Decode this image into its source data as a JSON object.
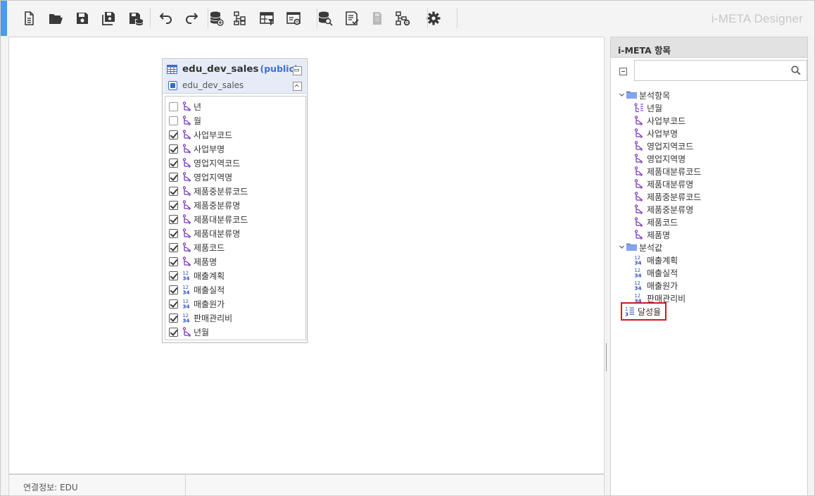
{
  "app": {
    "brand": "i-META Designer"
  },
  "toolbar": {
    "buttons": [
      {
        "name": "new-file-icon"
      },
      {
        "name": "open-folder-icon"
      },
      {
        "name": "save-icon"
      },
      {
        "name": "save-all-icon"
      },
      {
        "name": "save-db-icon"
      },
      {
        "name": "undo-icon"
      },
      {
        "name": "redo-icon"
      },
      {
        "name": "db-connect-icon"
      },
      {
        "name": "hierarchy-icon"
      },
      {
        "name": "table-filter-icon"
      },
      {
        "name": "window-settings-icon"
      },
      {
        "name": "db-search-icon"
      },
      {
        "name": "list-check-icon"
      },
      {
        "name": "document-disabled-icon"
      },
      {
        "name": "tree-settings-icon"
      },
      {
        "name": "gear-icon"
      }
    ]
  },
  "table": {
    "name": "edu_dev_sales",
    "schema": "(public)",
    "alias": "edu_dev_sales",
    "columns": [
      {
        "label": "년",
        "checked": false,
        "type": "dimension"
      },
      {
        "label": "월",
        "checked": false,
        "type": "dimension"
      },
      {
        "label": "사업부코드",
        "checked": true,
        "type": "dimension"
      },
      {
        "label": "사업부명",
        "checked": true,
        "type": "dimension"
      },
      {
        "label": "영업지역코드",
        "checked": true,
        "type": "dimension"
      },
      {
        "label": "영업지역명",
        "checked": true,
        "type": "dimension"
      },
      {
        "label": "제품중분류코드",
        "checked": true,
        "type": "dimension"
      },
      {
        "label": "제품중분류명",
        "checked": true,
        "type": "dimension"
      },
      {
        "label": "제품대분류코드",
        "checked": true,
        "type": "dimension"
      },
      {
        "label": "제품대분류명",
        "checked": true,
        "type": "dimension"
      },
      {
        "label": "제품코드",
        "checked": true,
        "type": "dimension"
      },
      {
        "label": "제품명",
        "checked": true,
        "type": "dimension"
      },
      {
        "label": "매출계획",
        "checked": true,
        "type": "measure"
      },
      {
        "label": "매출실적",
        "checked": true,
        "type": "measure"
      },
      {
        "label": "매출원가",
        "checked": true,
        "type": "measure"
      },
      {
        "label": "판매관리비",
        "checked": true,
        "type": "measure"
      },
      {
        "label": "년월",
        "checked": true,
        "type": "dimension"
      }
    ]
  },
  "status": {
    "connection": "연결정보: EDU"
  },
  "panel": {
    "title": "i-META 항목",
    "search_value": "",
    "groups": [
      {
        "label": "분석항목",
        "items": [
          {
            "label": "년월",
            "type": "date-dimension"
          },
          {
            "label": "사업부코드",
            "type": "dimension"
          },
          {
            "label": "사업부명",
            "type": "dimension"
          },
          {
            "label": "영업지역코드",
            "type": "dimension"
          },
          {
            "label": "영업지역명",
            "type": "dimension"
          },
          {
            "label": "제품대분류코드",
            "type": "dimension"
          },
          {
            "label": "제품대분류명",
            "type": "dimension"
          },
          {
            "label": "제품중분류코드",
            "type": "dimension"
          },
          {
            "label": "제품중분류명",
            "type": "dimension"
          },
          {
            "label": "제품코드",
            "type": "dimension"
          },
          {
            "label": "제품명",
            "type": "dimension"
          }
        ]
      },
      {
        "label": "분석값",
        "items": [
          {
            "label": "매출계획",
            "type": "measure"
          },
          {
            "label": "매출실적",
            "type": "measure"
          },
          {
            "label": "매출원가",
            "type": "measure"
          },
          {
            "label": "판매관리비",
            "type": "measure"
          },
          {
            "label": "달성율",
            "type": "calc-measure",
            "selected": true
          }
        ]
      }
    ]
  },
  "colors": {
    "accent": "#4b9af0",
    "schema": "#3d6fd1",
    "dimension_icon": "#7b3fb8",
    "measure_icon": "#2a4fc2",
    "selection": "#d01a1a"
  }
}
